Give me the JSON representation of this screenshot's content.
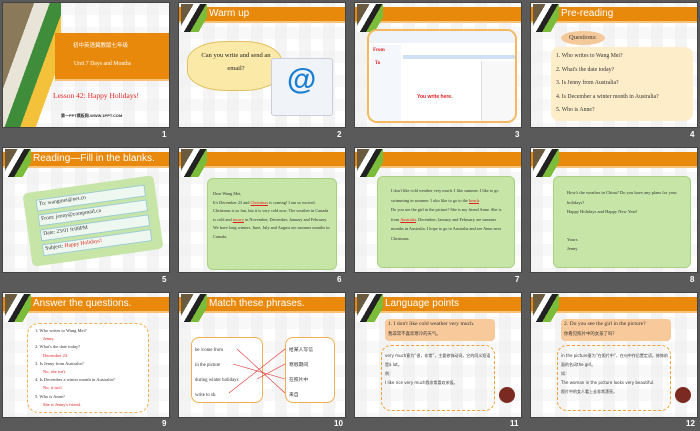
{
  "slides": [
    {
      "number": "1",
      "subtitle_cn": "初中英语冀教版七年级",
      "unit": "Unit 7  Days and Months",
      "lesson": "Lesson 42: Happy Holidays!",
      "site": "第一PPT模板网-WWW.1PPT.COM"
    },
    {
      "number": "2",
      "title": "Warm up",
      "bubble": "Can you write and send an email?",
      "icon": "email-at-icon"
    },
    {
      "number": "3",
      "from": "From",
      "to": "To",
      "write": "You write here."
    },
    {
      "number": "4",
      "title": "Pre-reading",
      "questions_label": "Questions:",
      "questions": [
        "1. Who writes to Wang Mei?",
        "2. What's the date today?",
        "3. Is Jenny from Australia?",
        "4. Is December a winter month in Australia?",
        "5. Who is Anne?"
      ]
    },
    {
      "number": "5",
      "title": "Reading—Fill  in the blanks.",
      "to": "To: wangmei@net.cn",
      "from": "From: jenny@compmail.ca",
      "date": "Date: 23/01 9:08PM",
      "subject_label": "Subject:",
      "subject": "Happy Holidays!"
    },
    {
      "number": "6",
      "lines": [
        "Dear Wang Mei,",
        "It's December 23 and",
        "is coming! I am so excited. Christmas is so fun, but it is very cold now. The weather in Canada is cold and",
        "in November, December, January and February. We have long winters. June, July and August are summer months in Canada."
      ],
      "blank1": "Christmas",
      "blank2": "snowy"
    },
    {
      "number": "7",
      "p1": "I don't like cold weather very much. I like summer. I like to go swimming in summer. I also like to go to the",
      "blank1": "beach",
      "p2": "Do you see the girl in the picture? She is my friend Anne. She is from",
      "blank2": "Australia",
      "p3": "December, January and February are summer months in Australia. I hope to go to Australia and see Anne next Christmas."
    },
    {
      "number": "8",
      "p1": "How's the weather in China? Do you have any plans for your holidays?",
      "p2": "Happy Holidays and Happy New Year!",
      "sign1": "Yours",
      "sign2": "Jenny"
    },
    {
      "number": "9",
      "title": "Answer the questions.",
      "qa": [
        [
          "1.   Who writes to Wang Mei?",
          "Jenny."
        ],
        [
          "2.  What's the date today?",
          "December 23."
        ],
        [
          "3.  Is Jenny from Australia?",
          "No, she isn't."
        ],
        [
          "4.  Is December  a winter month in Australia?",
          "No, it isn't."
        ],
        [
          "5.  Who is Anne?",
          "She is Jenny's friend."
        ]
      ]
    },
    {
      "number": "10",
      "title": "Match these phrases.",
      "left": [
        "be /come from",
        "in the picture",
        "during  winter holidays",
        "write to sb."
      ],
      "right": [
        "给某人写信",
        "寒假期间",
        "在照片中",
        "来自"
      ]
    },
    {
      "number": "11",
      "title": "Language points",
      "head": "1. I don't like cold weather very much.",
      "head_cn": "我非常不喜欢寒冷的天气。",
      "body": [
        "very much意为“很，非常”，主要修饰动词，它的同义短语是a lot。",
        "例：",
        "I like rice  very much我非常喜欢米饭。"
      ]
    },
    {
      "number": "12",
      "head": "2. Do you see the girl in the picture?",
      "head_cn": "你看见照片中的女孩了吗？",
      "body": [
        "in the picture意为“在照片中”，在句中作后置定语，修饰前面的名词the girl。",
        "如：",
        "The woman in the picture looks very  beautiful.",
        "照片中的女人看上去非常漂亮。"
      ]
    }
  ]
}
